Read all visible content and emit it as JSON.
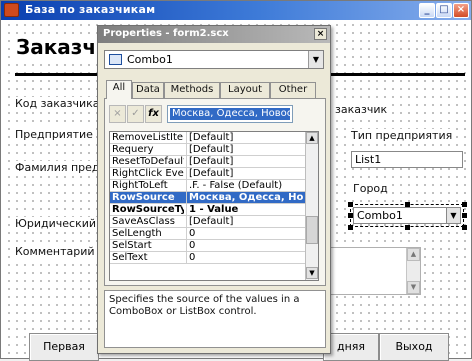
{
  "main_window": {
    "title": "База по заказчикам",
    "controls": {
      "minimize": "_",
      "maximize": "□",
      "close": "×"
    }
  },
  "form": {
    "heading": "Заказчик",
    "labels": {
      "code": "Код заказчика",
      "enterprise": "Предприятие",
      "surname": "Фамилия предс",
      "legal": "Юридический а",
      "comments": "Комментарий",
      "customer": "заказчик",
      "enterprise_type": "Тип предприятия",
      "city": "Город"
    },
    "fields": {
      "list_box": "List1",
      "combo_box": "Combo1"
    },
    "buttons": {
      "first": "Первая",
      "last": "дняя",
      "exit": "Выход"
    }
  },
  "properties": {
    "title": "Properties - form2.scx",
    "object_select": "Combo1",
    "tabs": [
      "All",
      "Data",
      "Methods",
      "Layout",
      "Other"
    ],
    "active_tab": "All",
    "value_bar": {
      "cancel": "×",
      "accept": "✓",
      "fx": "fx",
      "value": "Москва, Одесса, Новосиби"
    },
    "rows": [
      {
        "name": "RemoveListItem",
        "value": "[Default]",
        "state": "normal"
      },
      {
        "name": "Requery",
        "value": "[Default]",
        "state": "normal"
      },
      {
        "name": "ResetToDefault",
        "value": "[Default]",
        "state": "normal"
      },
      {
        "name": "RightClick Event",
        "value": "[Default]",
        "state": "normal"
      },
      {
        "name": "RightToLeft",
        "value": ".F. - False (Default)",
        "state": "normal"
      },
      {
        "name": "RowSource",
        "value": "Москва, Одесса, Нов",
        "state": "selected"
      },
      {
        "name": "RowSourceType",
        "value": "1 - Value",
        "state": "bold"
      },
      {
        "name": "SaveAsClass",
        "value": "[Default]",
        "state": "normal"
      },
      {
        "name": "SelLength",
        "value": "0",
        "state": "normal"
      },
      {
        "name": "SelStart",
        "value": "0",
        "state": "normal"
      },
      {
        "name": "SelText",
        "value": "0",
        "state": "normal"
      }
    ],
    "description": "Specifies the source of the values in a ComboBox or ListBox control."
  }
}
